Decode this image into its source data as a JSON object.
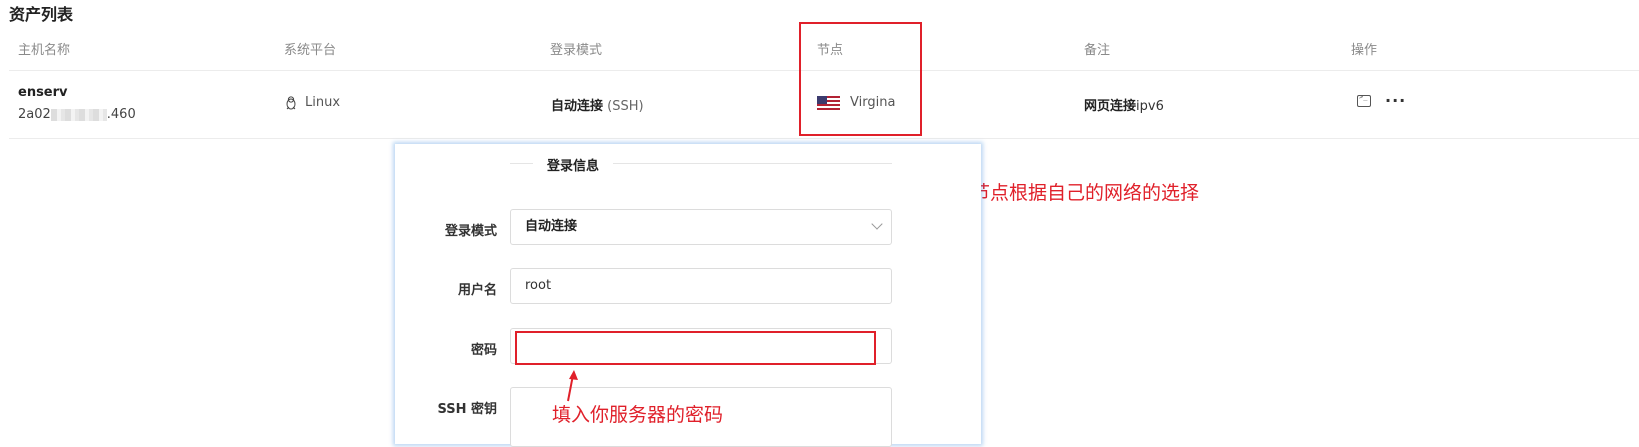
{
  "page": {
    "title": "资产列表"
  },
  "table": {
    "columns": [
      "主机名称",
      "系统平台",
      "登录模式",
      "节点",
      "备注",
      "操作"
    ],
    "rows": [
      {
        "host_name": "enserv",
        "host_ip_prefix": "2a02",
        "host_ip_suffix": ".460",
        "platform": "Linux",
        "platform_icon": "linux-penguin-icon",
        "login_mode_main": "自动连接",
        "login_mode_sub": "(SSH)",
        "node": "Virgina",
        "node_flag": "us-flag-icon",
        "note_main": "网页连接",
        "note_sub": "ipv6",
        "actions": [
          "terminal-icon",
          "more-icon"
        ]
      }
    ]
  },
  "dialog": {
    "section_title": "登录信息",
    "fields": {
      "login_mode": {
        "label": "登录模式",
        "value": "自动连接"
      },
      "username": {
        "label": "用户名",
        "value": "root"
      },
      "password": {
        "label": "密码",
        "value": ""
      },
      "ssh_key": {
        "label": "SSH 密钥",
        "value": ""
      }
    }
  },
  "annotations": {
    "node_note": "节点根据自己的网络的选择",
    "password_note": "填入你服务器的密码",
    "color": "#e0202a"
  }
}
